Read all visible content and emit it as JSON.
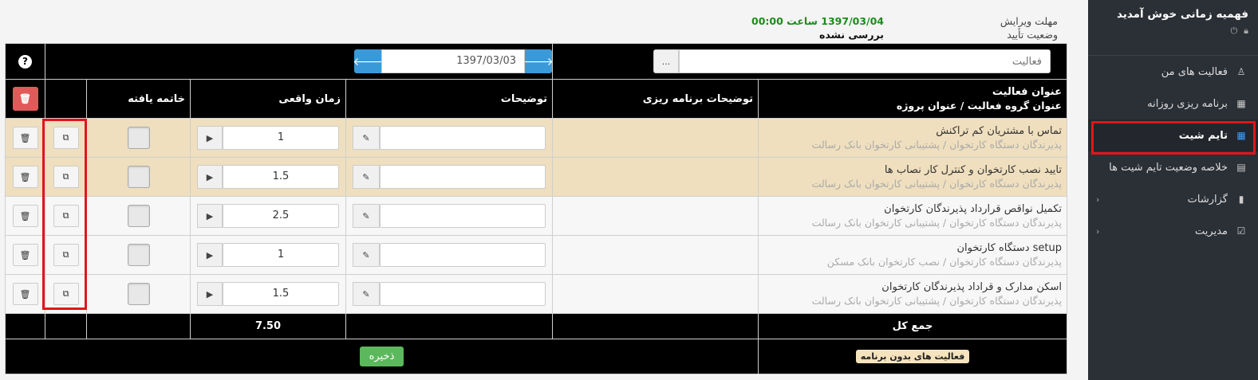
{
  "sidebar": {
    "welcome": "فهمیه زمانی خوش آمدید",
    "items": [
      {
        "label": "فعالیت های من",
        "icon": "person-icon",
        "glyph": "♙"
      },
      {
        "label": "برنامه ریزی روزانه",
        "icon": "table-icon",
        "glyph": "▦"
      },
      {
        "label": "تایم شیت",
        "icon": "calendar-icon",
        "glyph": "▦"
      },
      {
        "label": "خلاصه وضعیت تایم شیت ها",
        "icon": "list-icon",
        "glyph": "▤"
      },
      {
        "label": "گزارشات",
        "icon": "file-icon",
        "glyph": "▮"
      },
      {
        "label": "مدیریت",
        "icon": "checkbox-icon",
        "glyph": "☑"
      }
    ]
  },
  "info": {
    "deadline_label": "مهلت ویرایش",
    "status_label": "وضعیت تأیید",
    "deadline_value": "1397/03/04 ساعت 00:00",
    "status_value": "بررسی نشده"
  },
  "toolbar": {
    "activity_placeholder": "فعالیت",
    "browse_label": "...",
    "date": "1397/03/03",
    "help": "?"
  },
  "columns": {
    "title": "عنوان فعالیت",
    "title_sub": "عنوان گروه فعالیت  /  عنوان پروژه",
    "plan_desc": "توضیحات برنامه ریزی",
    "desc": "توضیحات",
    "actual_time": "زمان واقعی",
    "finished": "خاتمه یافته"
  },
  "rows": [
    {
      "title": "تماس با مشتریان کم تراکنش",
      "sub": "پذیرندگان دستگاه کارتخوان  /  پشتیبانی کارتخوان بانک رسالت",
      "time": "1"
    },
    {
      "title": "تایید نصب کارتخوان و کنترل کار نصاب ها",
      "sub": "پذیرندگان دستگاه کارتخوان  /  پشتیبانی کارتخوان بانک رسالت",
      "time": "1.5"
    },
    {
      "title": "تکمیل نواقص قرارداد پذیرندگان کارتخوان",
      "sub": "پذیرندگان دستگاه کارتخوان  /  پشتیبانی کارتخوان بانک رسالت",
      "time": "2.5"
    },
    {
      "title": "setup دستگاه کارتخوان",
      "sub": "پذیرندگان دستگاه کارتخوان  /  نصب کارتخوان بانک مسکن",
      "time": "1"
    },
    {
      "title": "اسکن مدارک و قراداد پذیرندگان کارتخوان",
      "sub": "پذیرندگان دستگاه کارتخوان  /  پشتیبانی کارتخوان بانک رسالت",
      "time": "1.5"
    }
  ],
  "total": {
    "label": "جمع کل",
    "value": "7.50"
  },
  "footer": {
    "unplanned_label": "فعالیت های بدون برنامه",
    "save_label": "ذخیره"
  },
  "colors": {
    "accent": "#3a9ad9",
    "danger": "#e05a5a",
    "success": "#5cb85c",
    "highlight": "#e3141c",
    "row_beige": "#efdfbe"
  }
}
